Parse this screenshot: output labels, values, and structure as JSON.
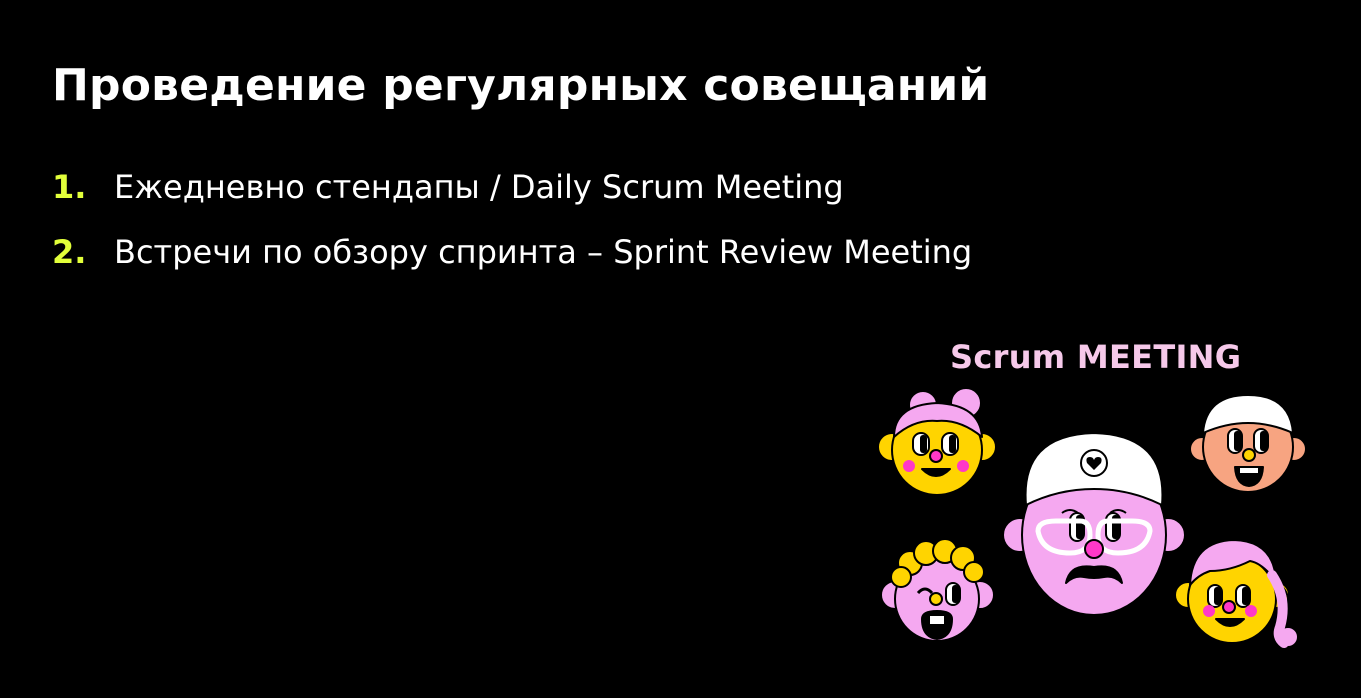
{
  "slide": {
    "title": "Проведение регулярных совещаний",
    "items": [
      {
        "number": "1.",
        "text": "Ежедневно стендапы / Daily Scrum Meeting"
      },
      {
        "number": "2.",
        "text": "Встречи по обзору спринта – Sprint Review Meeting"
      }
    ],
    "illustration": {
      "label": "Scrum MEETING",
      "icon": "scrum-team-faces-illustration"
    }
  },
  "colors": {
    "background": "#000000",
    "text": "#ffffff",
    "accent_number": "#e2ff3a",
    "label": "#f6c9ea",
    "yellow": "#ffd400",
    "pink": "#f5a8f0",
    "peach": "#f7a481",
    "magenta": "#ff38c8"
  }
}
